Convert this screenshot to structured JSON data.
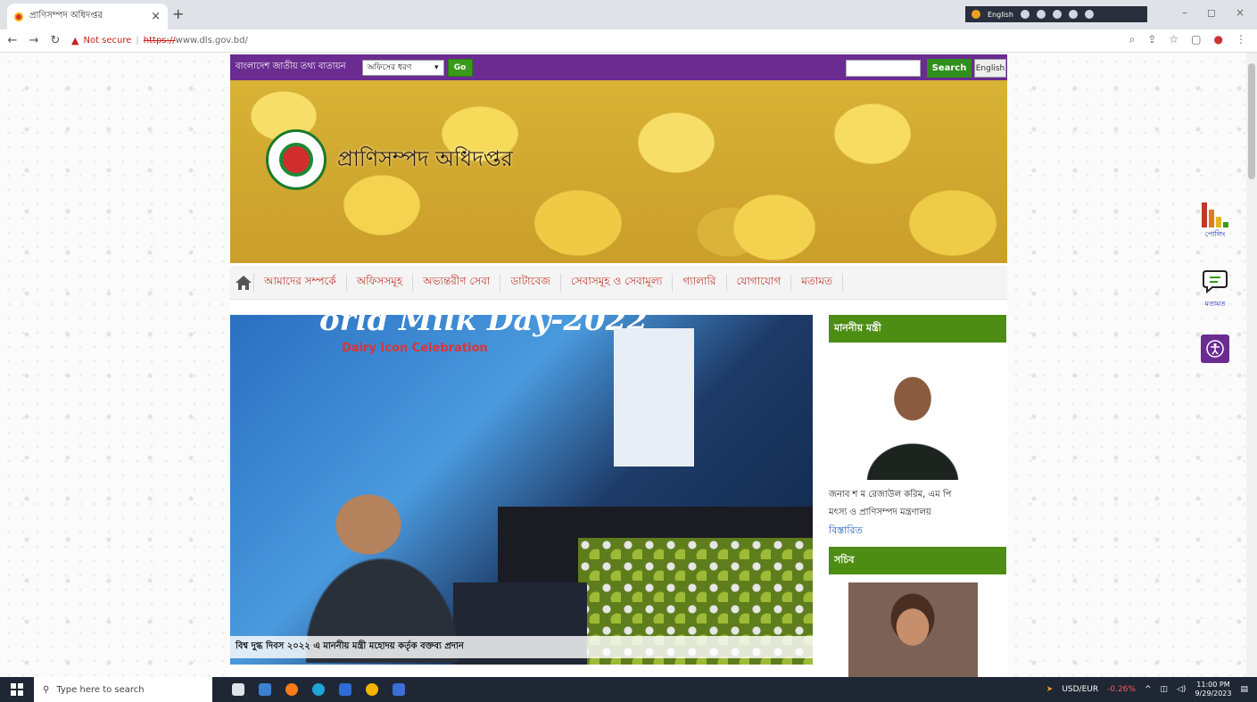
{
  "browser": {
    "tab_title": "প্রাণিসম্পদ অধিদপ্তর",
    "tab_close": "×",
    "new_tab": "+",
    "not_secure": "Not secure",
    "url_proto": "https://",
    "url_host": "www.dls.gov.bd/",
    "ext_lang": "English",
    "minimize": "–",
    "restore": "◻",
    "close": "×"
  },
  "topbar": {
    "portal_link": "বাংলাদেশ জাতীয় তথ্য বাতায়ন",
    "office_select": "অফিসের ধরণ",
    "go_label": "Go",
    "search_label": "Search",
    "language_label": "English"
  },
  "banner": {
    "site_title": "প্রাণিসম্পদ অধিদপ্তর"
  },
  "nav": {
    "items": [
      {
        "label": "আমাদের সম্পর্কে"
      },
      {
        "label": "অফিসসমূহ"
      },
      {
        "label": "অভ্যন্তরীণ সেবা"
      },
      {
        "label": "ডাটাবেজ"
      },
      {
        "label": "সেবাসমূহ ও সেবামূল্য"
      },
      {
        "label": "গ্যালারি"
      },
      {
        "label": "যোগাযোগ"
      },
      {
        "label": "মতামত"
      }
    ]
  },
  "slide": {
    "headline": "orld Milk Day-2022",
    "subtitle": "Dairy Icon Celebration",
    "caption": "বিশ্ব দুগ্ধ দিবস ২০২২ এ মাননীয় মন্ত্রী মহোদয় কর্তৃক বক্তব্য প্রদান"
  },
  "sidebar": {
    "minister_heading": "মাননীয় মন্ত্রী",
    "minister_name": "জনাব শ ম রেজাউল করিম, এম পি",
    "minister_ministry": "মৎস্য ও প্রাণিসম্পদ মন্ত্রণালয়",
    "more_link": "বিস্তারিত",
    "secretary_heading": "সচিব"
  },
  "floating": {
    "poll_label": "পোলিং",
    "opinion_label": "মতামত"
  },
  "taskbar": {
    "search_placeholder": "Type here to search",
    "ticker_label": "USD/EUR",
    "ticker_change": "-0.26%",
    "time": "11:00 PM",
    "date": "9/29/2023"
  },
  "colors": {
    "site_purple": "#6b2c91",
    "go_green": "#3a9a1a",
    "section_green": "#4e8d14",
    "nav_text": "#c0392b"
  }
}
